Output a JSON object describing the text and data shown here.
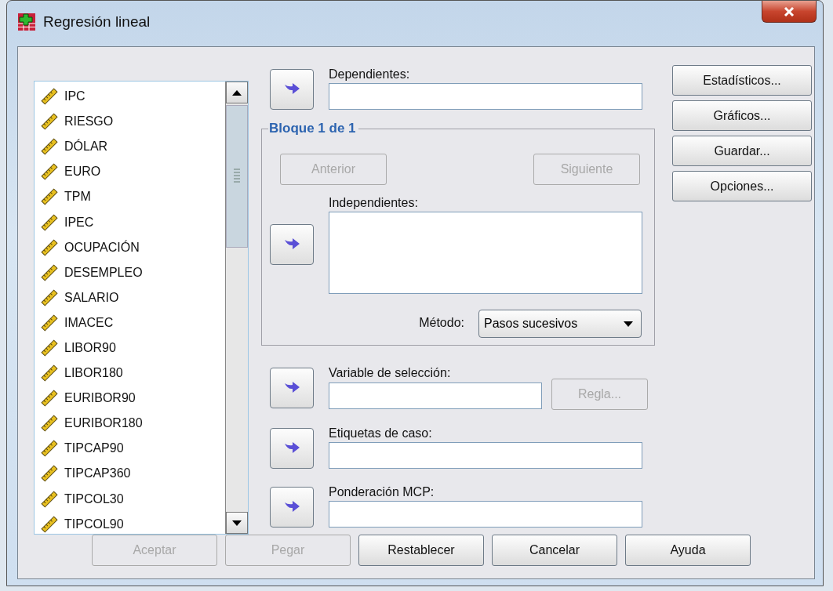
{
  "window": {
    "title": "Regresión lineal"
  },
  "variables": [
    "IPC",
    "RIESGO",
    "DÓLAR",
    "EURO",
    "TPM",
    "IPEC",
    "OCUPACIÓN",
    "DESEMPLEO",
    "SALARIO",
    "IMACEC",
    "LIBOR90",
    "LIBOR180",
    "EURIBOR90",
    "EURIBOR180",
    "TIPCAP90",
    "TIPCAP360",
    "TIPCOL30",
    "TIPCOL90"
  ],
  "dependents": {
    "label": "Dependientes:"
  },
  "block": {
    "title": "Bloque 1 de 1",
    "previous": {
      "label": "Anterior",
      "disabled": true
    },
    "next": {
      "label": "Siguiente",
      "disabled": true
    },
    "independents": {
      "label": "Independientes:"
    },
    "method": {
      "label": "Método:",
      "value": "Pasos sucesivos"
    }
  },
  "selection_variable": {
    "label": "Variable de selección:",
    "rule": {
      "label": "Regla...",
      "disabled": true
    }
  },
  "case_labels": {
    "label": "Etiquetas de caso:"
  },
  "wls_weight": {
    "label": "Ponderación MCP:"
  },
  "side_buttons": [
    {
      "label": "Estadísticos...",
      "disabled": false
    },
    {
      "label": "Gráficos...",
      "disabled": false
    },
    {
      "label": "Guardar...",
      "disabled": false
    },
    {
      "label": "Opciones...",
      "disabled": false
    }
  ],
  "footer_buttons": [
    {
      "label": "Aceptar",
      "disabled": true
    },
    {
      "label": "Pegar",
      "disabled": true
    },
    {
      "label": "Restablecer",
      "disabled": false
    },
    {
      "label": "Cancelar",
      "disabled": false
    },
    {
      "label": "Ayuda",
      "disabled": false
    }
  ]
}
